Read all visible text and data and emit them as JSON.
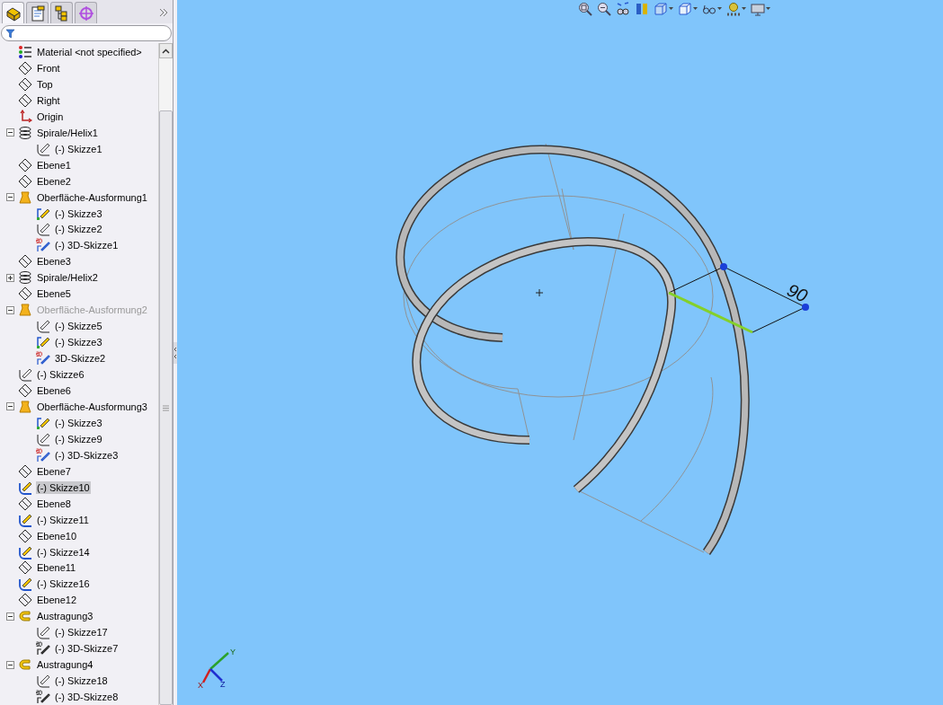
{
  "panel_tabs": [
    {
      "kind": "features",
      "selected": true
    },
    {
      "kind": "properties",
      "selected": false
    },
    {
      "kind": "configurations",
      "selected": false
    },
    {
      "kind": "dimxpert",
      "selected": false
    }
  ],
  "tree": [
    {
      "label": "Material <not specified>",
      "kind": "material"
    },
    {
      "label": "Front",
      "kind": "plane"
    },
    {
      "label": "Top",
      "kind": "plane"
    },
    {
      "label": "Right",
      "kind": "plane"
    },
    {
      "label": "Origin",
      "kind": "origin"
    },
    {
      "label": "Spirale/Helix1",
      "kind": "helix",
      "expanded": true,
      "children": [
        {
          "label": "(-) Skizze1",
          "kind": "sketch"
        }
      ]
    },
    {
      "label": "Ebene1",
      "kind": "plane"
    },
    {
      "label": "Ebene2",
      "kind": "plane"
    },
    {
      "label": "Oberfläche-Ausformung1",
      "kind": "loft",
      "expanded": true,
      "children": [
        {
          "label": "(-) Skizze3",
          "kind": "sketch-shared"
        },
        {
          "label": "(-) Skizze2",
          "kind": "sketch"
        },
        {
          "label": "(-) 3D-Skizze1",
          "kind": "sketch-3d"
        }
      ]
    },
    {
      "label": "Ebene3",
      "kind": "plane"
    },
    {
      "label": "Spirale/Helix2",
      "kind": "helix",
      "expanded": false
    },
    {
      "label": "Ebene5",
      "kind": "plane"
    },
    {
      "label": "Oberfläche-Ausformung2",
      "kind": "loft",
      "expanded": true,
      "disabled": true,
      "children": [
        {
          "label": "(-) Skizze5",
          "kind": "sketch"
        },
        {
          "label": "(-) Skizze3",
          "kind": "sketch-shared"
        },
        {
          "label": "3D-Skizze2",
          "kind": "sketch-3d"
        }
      ]
    },
    {
      "label": "(-) Skizze6",
      "kind": "sketch"
    },
    {
      "label": "Ebene6",
      "kind": "plane"
    },
    {
      "label": "Oberfläche-Ausformung3",
      "kind": "loft",
      "expanded": true,
      "children": [
        {
          "label": "(-) Skizze3",
          "kind": "sketch-shared"
        },
        {
          "label": "(-) Skizze9",
          "kind": "sketch"
        },
        {
          "label": "(-) 3D-Skizze3",
          "kind": "sketch-3d"
        }
      ]
    },
    {
      "label": "Ebene7",
      "kind": "plane"
    },
    {
      "label": "(-) Skizze10",
      "kind": "sketch-path",
      "selected": true
    },
    {
      "label": "Ebene8",
      "kind": "plane"
    },
    {
      "label": "(-) Skizze11",
      "kind": "sketch-path"
    },
    {
      "label": "Ebene10",
      "kind": "plane"
    },
    {
      "label": "(-) Skizze14",
      "kind": "sketch-path"
    },
    {
      "label": "Ebene11",
      "kind": "plane"
    },
    {
      "label": "(-) Skizze16",
      "kind": "sketch-path"
    },
    {
      "label": "Ebene12",
      "kind": "plane"
    },
    {
      "label": "Austragung3",
      "kind": "sweep",
      "expanded": true,
      "children": [
        {
          "label": "(-) Skizze17",
          "kind": "sketch"
        },
        {
          "label": "(-) 3D-Skizze7",
          "kind": "sketch-3d-plain"
        }
      ]
    },
    {
      "label": "Austragung4",
      "kind": "sweep",
      "expanded": true,
      "children": [
        {
          "label": "(-) Skizze18",
          "kind": "sketch"
        },
        {
          "label": "(-) 3D-Skizze8",
          "kind": "sketch-3d-plain"
        }
      ]
    }
  ],
  "viewport": {
    "dimension": "90",
    "axes": {
      "x": "X",
      "y": "Y",
      "z": "Z"
    }
  },
  "view_toolbar": [
    {
      "kind": "zoom-fit",
      "dropdown": false
    },
    {
      "kind": "zoom-area",
      "dropdown": false
    },
    {
      "kind": "previous-view",
      "dropdown": false
    },
    {
      "kind": "section-view",
      "dropdown": false
    },
    {
      "kind": "view-orientation",
      "dropdown": true
    },
    {
      "kind": "display-style",
      "dropdown": true
    },
    {
      "kind": "hide-show",
      "dropdown": true
    },
    {
      "kind": "appearance",
      "dropdown": true
    },
    {
      "kind": "scene",
      "dropdown": true
    }
  ]
}
